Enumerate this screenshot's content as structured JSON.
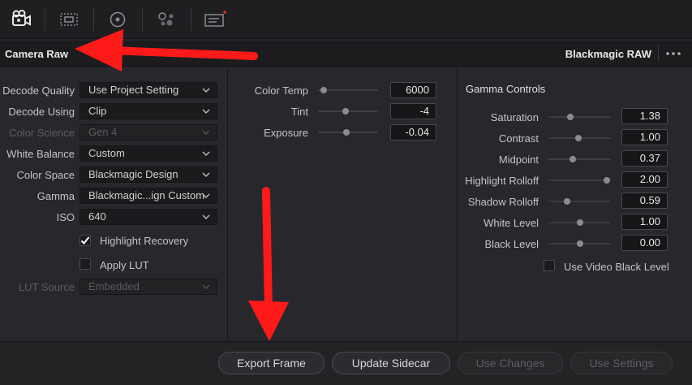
{
  "header": {
    "title": "Camera Raw",
    "codec": "Blackmagic RAW",
    "more_icon": "ellipsis-icon"
  },
  "toolbar": {
    "icons": [
      "camera-icon",
      "scopes-icon",
      "color-wheel-icon",
      "nodes-icon",
      "metadata-icon"
    ]
  },
  "left_panel": {
    "fields": [
      {
        "label": "Decode Quality",
        "value": "Use Project Setting",
        "disabled": false
      },
      {
        "label": "Decode Using",
        "value": "Clip",
        "disabled": false
      },
      {
        "label": "Color Science",
        "value": "Gen 4",
        "disabled": true
      },
      {
        "label": "White Balance",
        "value": "Custom",
        "disabled": false
      },
      {
        "label": "Color Space",
        "value": "Blackmagic Design",
        "disabled": false
      },
      {
        "label": "Gamma",
        "value": "Blackmagic...ign Custom",
        "disabled": false
      },
      {
        "label": "ISO",
        "value": "640",
        "disabled": false
      }
    ],
    "highlight_recovery": {
      "label": "Highlight Recovery",
      "checked": true
    },
    "apply_lut": {
      "label": "Apply LUT",
      "checked": false
    },
    "lut_source": {
      "label": "LUT Source",
      "value": "Embedded",
      "disabled": true
    }
  },
  "middle_panel": {
    "sliders": [
      {
        "label": "Color Temp",
        "value": "6000",
        "fraction": 0.05
      },
      {
        "label": "Tint",
        "value": "-4",
        "fraction": 0.45
      },
      {
        "label": "Exposure",
        "value": "-0.04",
        "fraction": 0.47
      }
    ]
  },
  "right_panel": {
    "title": "Gamma Controls",
    "sliders": [
      {
        "label": "Saturation",
        "value": "1.38",
        "fraction": 0.33
      },
      {
        "label": "Contrast",
        "value": "1.00",
        "fraction": 0.48
      },
      {
        "label": "Midpoint",
        "value": "0.37",
        "fraction": 0.37
      },
      {
        "label": "Highlight Rolloff",
        "value": "2.00",
        "fraction": 0.98
      },
      {
        "label": "Shadow Rolloff",
        "value": "0.59",
        "fraction": 0.28
      },
      {
        "label": "White Level",
        "value": "1.00",
        "fraction": 0.5
      },
      {
        "label": "Black Level",
        "value": "0.00",
        "fraction": 0.5
      }
    ],
    "use_video_black_level": {
      "label": "Use Video Black Level",
      "checked": false
    }
  },
  "footer": {
    "export_frame": "Export Frame",
    "update_sidecar": "Update Sidecar",
    "use_changes": "Use Changes",
    "use_settings": "Use Settings"
  },
  "colors": {
    "annotation_arrow": "#ff1a1a",
    "background": "#28282c",
    "notification_dot": "#e0302a"
  }
}
